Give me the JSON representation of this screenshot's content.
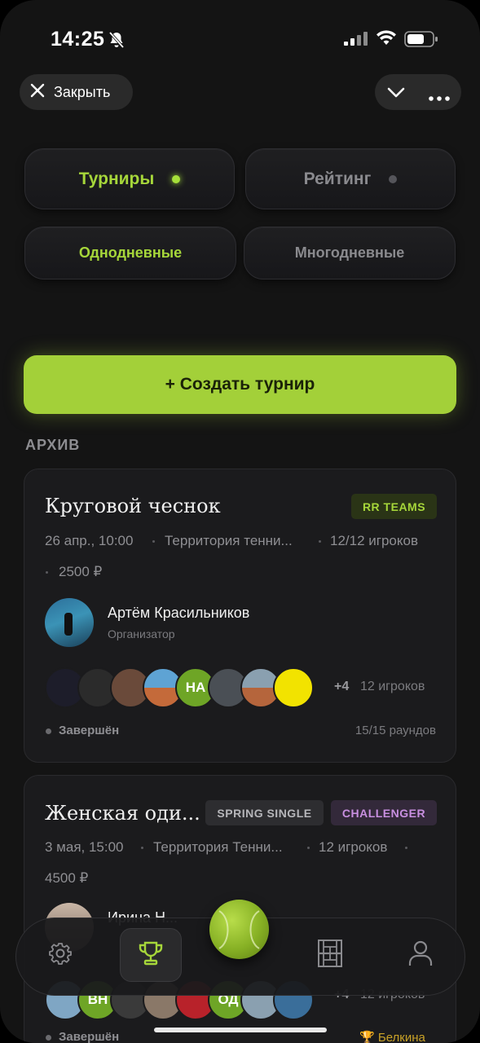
{
  "status_bar": {
    "time": "14:25",
    "icons": [
      "bell-slash-icon",
      "signal-icon",
      "wifi-icon",
      "battery-icon"
    ]
  },
  "header": {
    "close_label": "Закрыть",
    "icons": [
      "close-icon",
      "chevron-down-icon",
      "more-dots-icon"
    ]
  },
  "tabs": {
    "main": [
      {
        "label": "Турниры",
        "active": true
      },
      {
        "label": "Рейтинг",
        "active": false
      }
    ],
    "sub": [
      {
        "label": "Однодневные",
        "active": true
      },
      {
        "label": "Многодневные",
        "active": false
      }
    ]
  },
  "create_button": {
    "label": "+ Создать турнир"
  },
  "section_label": "АРХИВ",
  "cards": [
    {
      "title": "Круговой чеснок",
      "badges": [
        {
          "text": "RR TEAMS",
          "style": "green"
        }
      ],
      "date": "26 апр., 10:00",
      "venue": "Территория тенни...",
      "players_count": "12/12 игроков",
      "price": "2500 ₽",
      "organizer": {
        "name": "Артём Красильников",
        "role": "Организатор"
      },
      "participant_avatars": [
        "",
        "",
        "",
        "",
        "НА",
        "",
        "",
        ""
      ],
      "more": "+4",
      "players_label": "12 игроков",
      "status": "Завершён",
      "rounds": "15/15 раундов"
    },
    {
      "title": "Женская оди...",
      "badges": [
        {
          "text": "SPRING SINGLE",
          "style": "gray"
        },
        {
          "text": "CHALLENGER",
          "style": "purple"
        }
      ],
      "date": "3 мая, 15:00",
      "venue": "Территория Тенни...",
      "players_count": "12 игроков",
      "price": "4500 ₽",
      "organizer": {
        "name": "Ирина Н...",
        "role": ""
      },
      "participant_avatars": [
        "",
        "ВН",
        "",
        "",
        "",
        "ОД",
        "",
        ""
      ],
      "more": "+4",
      "players_label": "12 игроков",
      "status": "Завершён",
      "winner": "Белкина"
    }
  ],
  "tab_bar": {
    "items": [
      "settings-icon",
      "trophy-icon",
      "tennis-ball-icon",
      "court-icon",
      "profile-icon"
    ],
    "active": "trophy-icon"
  },
  "colors": {
    "accent": "#a3d039",
    "background": "#141414",
    "card": "#1b1b1d"
  }
}
